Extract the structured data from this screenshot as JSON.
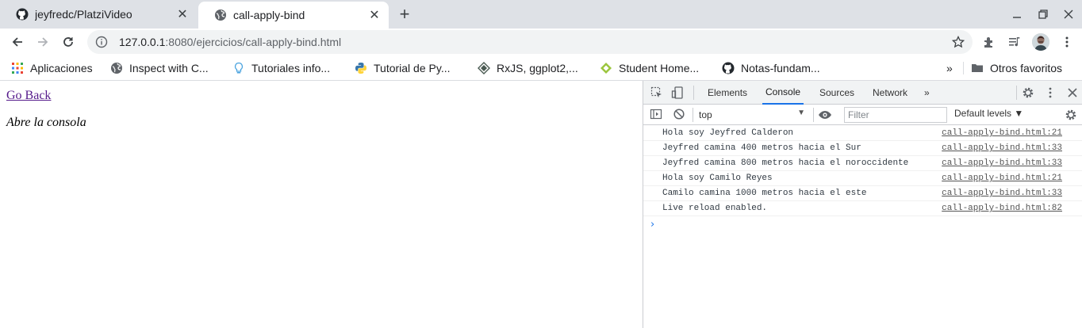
{
  "tabs": [
    {
      "title": "jeyfredc/PlatziVideo",
      "favicon": "github-icon"
    },
    {
      "title": "call-apply-bind",
      "favicon": "globe-icon"
    }
  ],
  "omnibox": {
    "host": "127.0.0.1",
    "path": ":8080/ejercicios/call-apply-bind.html"
  },
  "bookmarks": [
    {
      "label": "Aplicaciones",
      "icon": "apps-grid-icon"
    },
    {
      "label": "Inspect with C...",
      "icon": "globe-icon"
    },
    {
      "label": "Tutoriales info...",
      "icon": "lightbulb-icon"
    },
    {
      "label": "Tutorial de Py...",
      "icon": "python-icon"
    },
    {
      "label": "RxJS, ggplot2,...",
      "icon": "diamond-icon"
    },
    {
      "label": "Student Home...",
      "icon": "green-diamond-icon"
    },
    {
      "label": "Notas-fundam...",
      "icon": "github-icon"
    }
  ],
  "bookmarks_overflow": "»",
  "other_bookmarks": "Otros favoritos",
  "page": {
    "go_back": "Go Back",
    "hint": "Abre la consola"
  },
  "devtools": {
    "tabs": [
      "Elements",
      "Console",
      "Sources",
      "Network"
    ],
    "active_tab": "Console",
    "more_tabs": "»",
    "context": "top",
    "filter_placeholder": "Filter",
    "levels": "Default levels ▼",
    "logs": [
      {
        "message": "Hola soy Jeyfred Calderon",
        "source": "call-apply-bind.html:21"
      },
      {
        "message": "Jeyfred camina 400 metros hacia el Sur",
        "source": "call-apply-bind.html:33"
      },
      {
        "message": "Jeyfred camina 800 metros hacia el noroccidente",
        "source": "call-apply-bind.html:33"
      },
      {
        "message": "Hola soy Camilo Reyes",
        "source": "call-apply-bind.html:21"
      },
      {
        "message": "Camilo camina 1000 metros hacia el este",
        "source": "call-apply-bind.html:33"
      },
      {
        "message": "Live reload enabled.",
        "source": "call-apply-bind.html:82"
      }
    ],
    "prompt": "›"
  },
  "colors": {
    "tabstrip": "#dee1e6",
    "omnibox": "#f1f3f4",
    "link_visited": "#551a8b",
    "devtools_accent": "#1a73e8"
  }
}
